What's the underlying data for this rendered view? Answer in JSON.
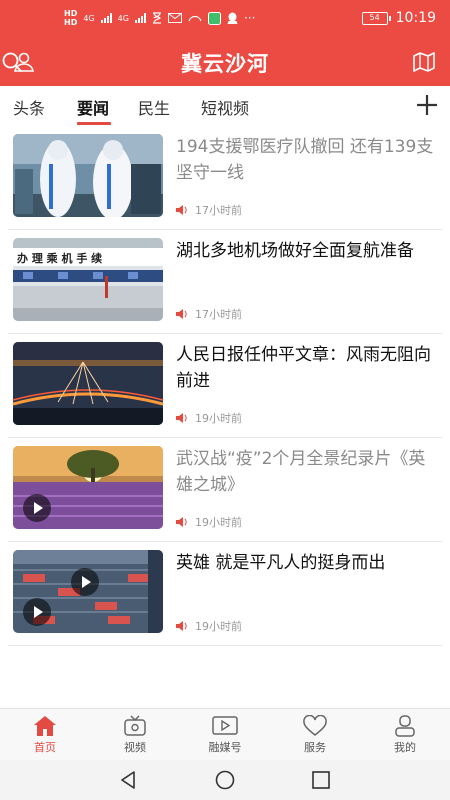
{
  "status_bar": {
    "hd1": "HD",
    "hd2": "HD",
    "net1": "4G",
    "net2": "4G",
    "more": "···",
    "battery": "54",
    "time": "10:19"
  },
  "header": {
    "title": "冀云沙河",
    "colors": {
      "brand": "#ec4b43"
    }
  },
  "tabs": [
    {
      "label": "头条",
      "active": false
    },
    {
      "label": "要闻",
      "active": true
    },
    {
      "label": "民生",
      "active": false
    },
    {
      "label": "短视频",
      "active": false
    }
  ],
  "news": [
    {
      "title": "194支援鄂医疗队撤回 还有139支坚守一线",
      "time": "17小时前",
      "read": true,
      "video": false
    },
    {
      "title": "湖北多地机场做好全面复航准备",
      "time": "17小时前",
      "read": false,
      "video": false
    },
    {
      "title": "人民日报任仲平文章：风雨无阻向前进",
      "time": "19小时前",
      "read": false,
      "video": false
    },
    {
      "title": "武汉战“疫”2个月全景纪录片《英雄之城》",
      "time": "19小时前",
      "read": true,
      "video": true
    },
    {
      "title": "英雄 就是平凡人的挺身而出",
      "time": "19小时前",
      "read": false,
      "video": true
    }
  ],
  "bottom_nav": [
    {
      "label": "首页",
      "icon": "home-icon",
      "active": true
    },
    {
      "label": "视频",
      "icon": "tv-icon",
      "active": false
    },
    {
      "label": "融媒号",
      "icon": "media-play-icon",
      "active": false
    },
    {
      "label": "服务",
      "icon": "heart-icon",
      "active": false
    },
    {
      "label": "我的",
      "icon": "user-icon",
      "active": false
    }
  ],
  "thumb_signs": {
    "airport": "办 理 乘 机 手 续"
  }
}
